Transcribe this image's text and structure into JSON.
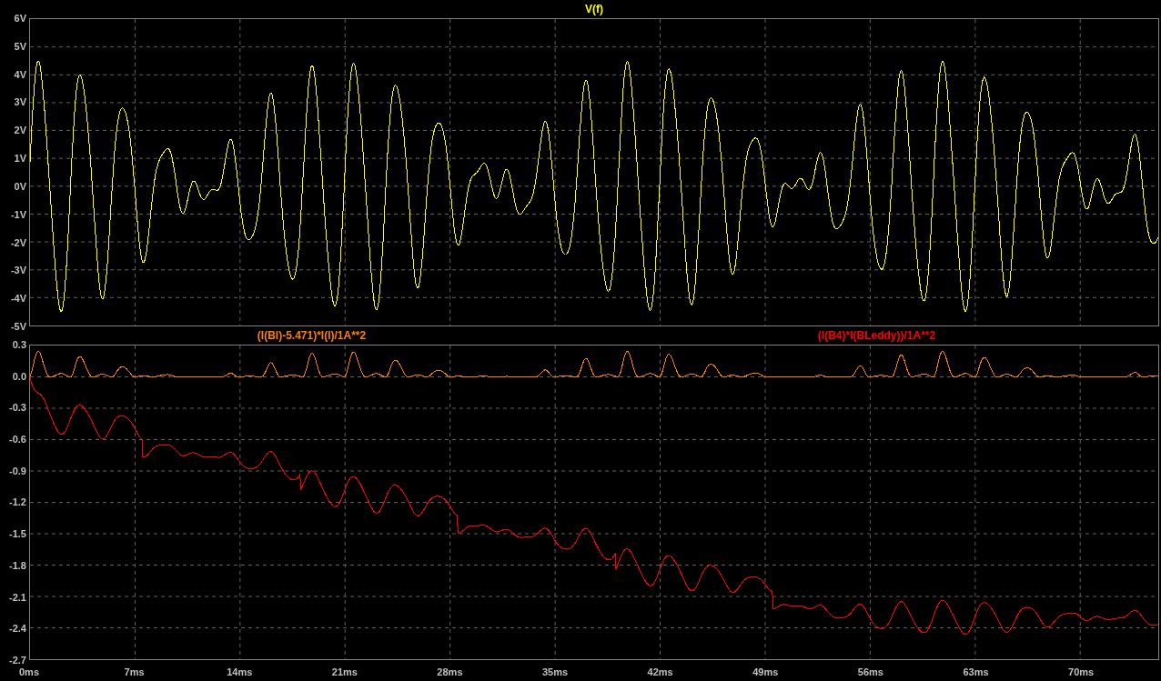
{
  "plots": [
    {
      "traces": [
        {
          "label": "V(f)",
          "color": "#ffff00"
        }
      ],
      "yticks": [
        "6V",
        "5V",
        "4V",
        "3V",
        "2V",
        "1V",
        "0V",
        "-1V",
        "-2V",
        "-3V",
        "-4V",
        "-5V"
      ]
    },
    {
      "traces": [
        {
          "label": "(I(Bl)-5.471)*I(l)/1A**2",
          "color": "#ff8000"
        },
        {
          "label": "(I(B4)*I(BLeddy))/1A**2",
          "color": "#ff0000"
        }
      ],
      "yticks": [
        "0.3",
        "0.0",
        "-0.3",
        "-0.6",
        "-0.9",
        "-1.2",
        "-1.5",
        "-1.8",
        "-2.1",
        "-2.4",
        "-2.7"
      ]
    }
  ],
  "xticks": [
    "0ms",
    "7ms",
    "14ms",
    "21ms",
    "28ms",
    "35ms",
    "42ms",
    "49ms",
    "56ms",
    "63ms",
    "70ms"
  ]
}
